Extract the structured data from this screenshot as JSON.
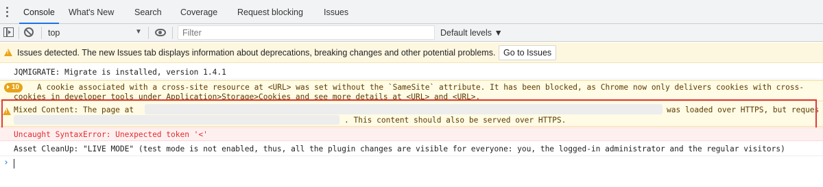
{
  "tabs": [
    "Console",
    "What's New",
    "Search",
    "Coverage",
    "Request blocking",
    "Issues"
  ],
  "toolbar": {
    "context": "top",
    "context_arrow": "▼",
    "filter_placeholder": "Filter",
    "levels_label": "Default levels ▼"
  },
  "issues_banner": {
    "text": "Issues detected. The new Issues tab displays information about deprecations, breaking changes and other potential problems.",
    "button": "Go to Issues"
  },
  "messages": {
    "jqmigrate": "JQMIGRATE: Migrate is installed, version 1.4.1",
    "cookie": {
      "count": "10",
      "line1": "A cookie associated with a cross-site resource at <URL> was set without the `SameSite` attribute. It has been blocked, as Chrome now only delivers cookies with cross-",
      "line2": "cookies in developer tools under Application>Storage>Cookies and see more details at <URL> and <URL>."
    },
    "mixed_content": {
      "label": "Mixed Content: The page at",
      "tail": "was loaded over HTTPS, but reques",
      "line2": ". This content should also be served over HTTPS."
    },
    "syntax_error": "Uncaught SyntaxError: Unexpected token '<'",
    "asset_cleanup": "Asset CleanUp: \"LIVE MODE\" (test mode is not enabled, thus, all the plugin changes are visible for everyone: you, the logged-in administrator and the regular visitors)"
  },
  "prompt": "›",
  "colors": {
    "accent": "#1a73e8",
    "warning": "#e8a317",
    "error": "#e02c2c",
    "highlight": "#e0393e"
  }
}
